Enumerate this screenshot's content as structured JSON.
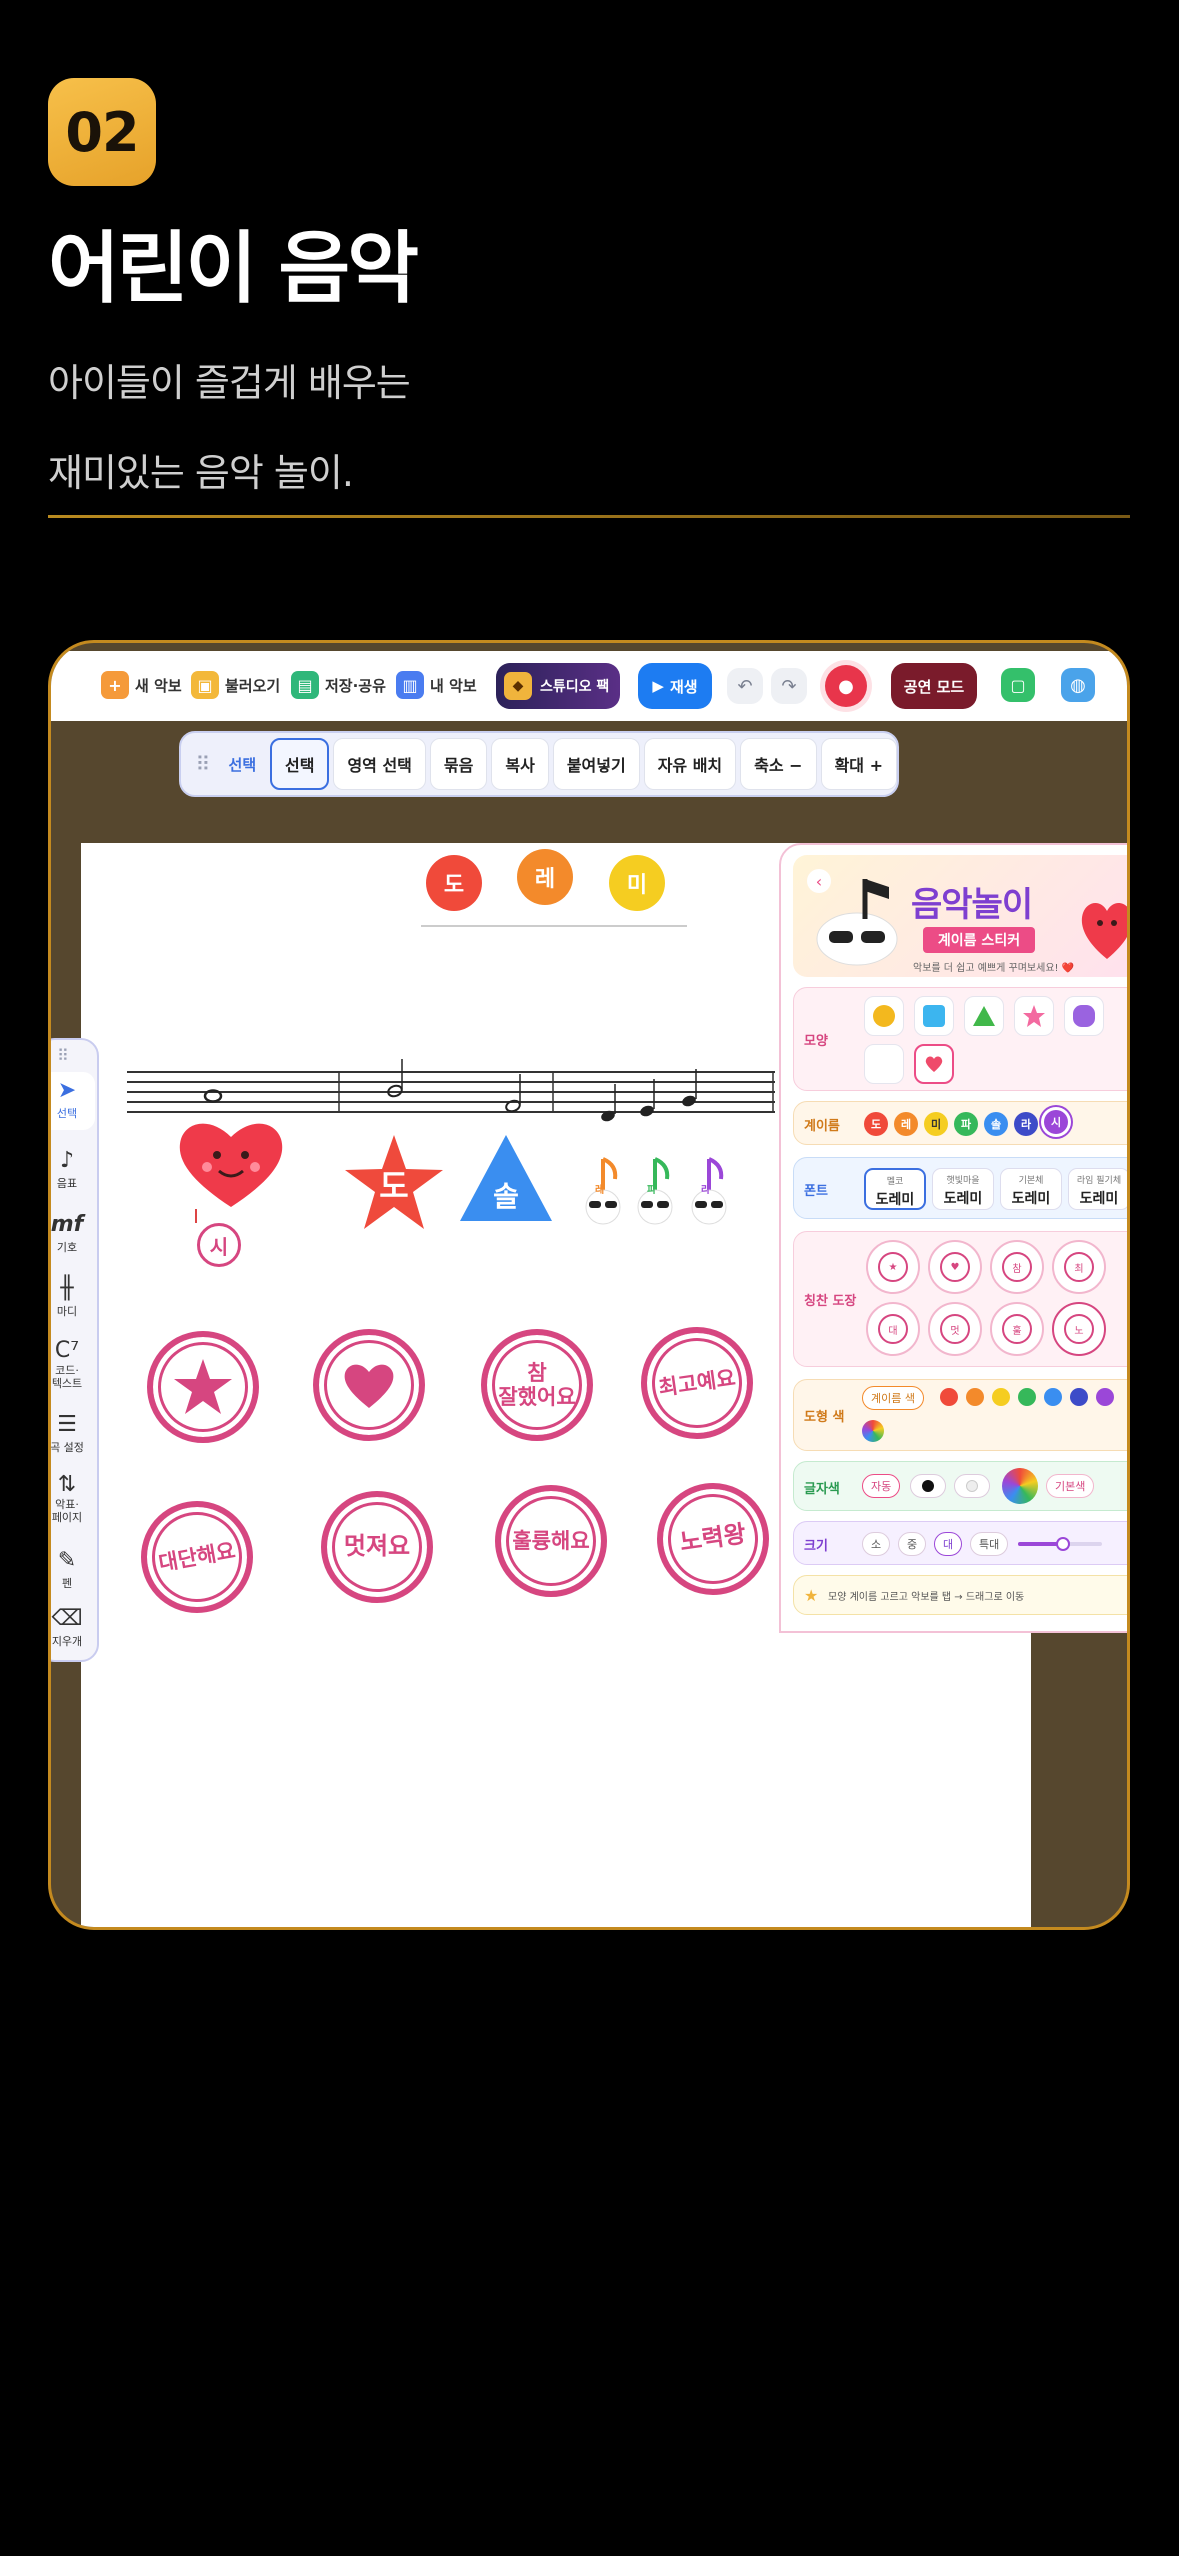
{
  "hero": {
    "badge": "02",
    "title": "어린이 음악",
    "subtitle_line1": "아이들이 즐겁게 배우는",
    "subtitle_line2": "재미있는 음악 놀이."
  },
  "topbar": {
    "new_score": "새 악보",
    "load": "불러오기",
    "save_share": "저장·공유",
    "my_scores": "내 악보",
    "studio_pack": "스튜디오 팩",
    "play": "재생",
    "performance_mode": "공연 모드"
  },
  "selection_toolbar": {
    "label": "선택",
    "buttons": [
      "선택",
      "영역 선택",
      "묶음",
      "복사",
      "붙여넣기",
      "자유 배치",
      "축소 −",
      "확대 +"
    ]
  },
  "score": {
    "title_notes": [
      "도",
      "레",
      "미"
    ],
    "stickers": {
      "heart_label": "시",
      "star_label": "도",
      "triangle_label": "솔",
      "note_labels": [
        "레",
        "파",
        "라"
      ]
    },
    "stamps": [
      "참\n잘했어요",
      "최고예요",
      "대단해요",
      "멋져요",
      "훌륭해요",
      "노력왕"
    ]
  },
  "tool_rail": {
    "items": [
      "선택",
      "음표",
      "기호",
      "마디",
      "코드·\n텍스트",
      "곡 설정",
      "악표·\n페이지",
      "펜",
      "지우개"
    ]
  },
  "panel": {
    "title": "음악놀이",
    "ribbon": "계이름 스티커",
    "subtitle": "악보를 더 쉽고 예쁘게 꾸며보세요! ❤️",
    "shape_label": "모양",
    "scale_label": "계이름",
    "scale_notes": [
      "도",
      "레",
      "미",
      "파",
      "솔",
      "라",
      "시"
    ],
    "font_label": "폰트",
    "fonts": [
      {
        "caption": "멜코",
        "sample": "도레미"
      },
      {
        "caption": "햇빛마을",
        "sample": "도레미"
      },
      {
        "caption": "기본체",
        "sample": "도레미"
      },
      {
        "caption": "라임 필기체",
        "sample": "도레미"
      }
    ],
    "stamp_label": "칭찬 도장",
    "shape_color_label": "도형 색",
    "shape_color_default": "계이름 색",
    "text_color_label": "글자색",
    "text_color_auto": "자동",
    "text_color_default": "기본색",
    "size_label": "크기",
    "sizes": [
      "소",
      "중",
      "대",
      "특대"
    ],
    "hint": "모양 계이름 고르고 악보를 탭 → 드래그로 이동"
  },
  "colors": {
    "accent_gold": "#f0b43c",
    "stamp_pink": "#d64680",
    "play_blue": "#1d7cf2",
    "note_do": "#f04a3a",
    "note_re": "#f38a2b",
    "note_mi": "#f5cd21",
    "note_fa": "#36b85a",
    "note_sol": "#3a8ef0",
    "note_la": "#3d4bc8",
    "note_si": "#9b47d8"
  }
}
